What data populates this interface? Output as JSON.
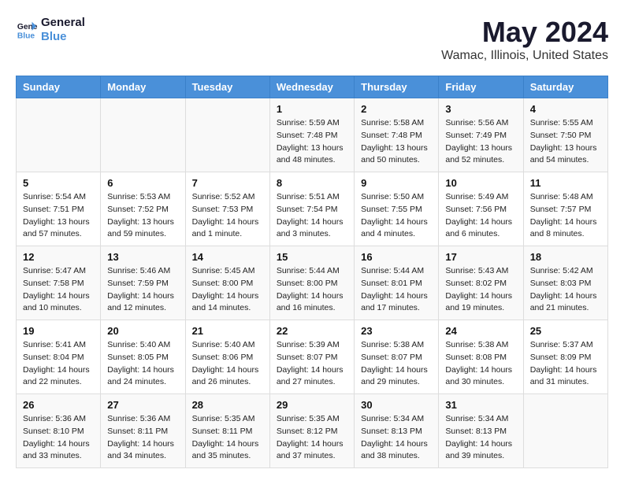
{
  "header": {
    "logo_line1": "General",
    "logo_line2": "Blue",
    "title": "May 2024",
    "subtitle": "Wamac, Illinois, United States"
  },
  "calendar": {
    "days_of_week": [
      "Sunday",
      "Monday",
      "Tuesday",
      "Wednesday",
      "Thursday",
      "Friday",
      "Saturday"
    ],
    "weeks": [
      [
        {
          "day": "",
          "sunrise": "",
          "sunset": "",
          "daylight": ""
        },
        {
          "day": "",
          "sunrise": "",
          "sunset": "",
          "daylight": ""
        },
        {
          "day": "",
          "sunrise": "",
          "sunset": "",
          "daylight": ""
        },
        {
          "day": "1",
          "sunrise": "Sunrise: 5:59 AM",
          "sunset": "Sunset: 7:48 PM",
          "daylight": "Daylight: 13 hours and 48 minutes."
        },
        {
          "day": "2",
          "sunrise": "Sunrise: 5:58 AM",
          "sunset": "Sunset: 7:48 PM",
          "daylight": "Daylight: 13 hours and 50 minutes."
        },
        {
          "day": "3",
          "sunrise": "Sunrise: 5:56 AM",
          "sunset": "Sunset: 7:49 PM",
          "daylight": "Daylight: 13 hours and 52 minutes."
        },
        {
          "day": "4",
          "sunrise": "Sunrise: 5:55 AM",
          "sunset": "Sunset: 7:50 PM",
          "daylight": "Daylight: 13 hours and 54 minutes."
        }
      ],
      [
        {
          "day": "5",
          "sunrise": "Sunrise: 5:54 AM",
          "sunset": "Sunset: 7:51 PM",
          "daylight": "Daylight: 13 hours and 57 minutes."
        },
        {
          "day": "6",
          "sunrise": "Sunrise: 5:53 AM",
          "sunset": "Sunset: 7:52 PM",
          "daylight": "Daylight: 13 hours and 59 minutes."
        },
        {
          "day": "7",
          "sunrise": "Sunrise: 5:52 AM",
          "sunset": "Sunset: 7:53 PM",
          "daylight": "Daylight: 14 hours and 1 minute."
        },
        {
          "day": "8",
          "sunrise": "Sunrise: 5:51 AM",
          "sunset": "Sunset: 7:54 PM",
          "daylight": "Daylight: 14 hours and 3 minutes."
        },
        {
          "day": "9",
          "sunrise": "Sunrise: 5:50 AM",
          "sunset": "Sunset: 7:55 PM",
          "daylight": "Daylight: 14 hours and 4 minutes."
        },
        {
          "day": "10",
          "sunrise": "Sunrise: 5:49 AM",
          "sunset": "Sunset: 7:56 PM",
          "daylight": "Daylight: 14 hours and 6 minutes."
        },
        {
          "day": "11",
          "sunrise": "Sunrise: 5:48 AM",
          "sunset": "Sunset: 7:57 PM",
          "daylight": "Daylight: 14 hours and 8 minutes."
        }
      ],
      [
        {
          "day": "12",
          "sunrise": "Sunrise: 5:47 AM",
          "sunset": "Sunset: 7:58 PM",
          "daylight": "Daylight: 14 hours and 10 minutes."
        },
        {
          "day": "13",
          "sunrise": "Sunrise: 5:46 AM",
          "sunset": "Sunset: 7:59 PM",
          "daylight": "Daylight: 14 hours and 12 minutes."
        },
        {
          "day": "14",
          "sunrise": "Sunrise: 5:45 AM",
          "sunset": "Sunset: 8:00 PM",
          "daylight": "Daylight: 14 hours and 14 minutes."
        },
        {
          "day": "15",
          "sunrise": "Sunrise: 5:44 AM",
          "sunset": "Sunset: 8:00 PM",
          "daylight": "Daylight: 14 hours and 16 minutes."
        },
        {
          "day": "16",
          "sunrise": "Sunrise: 5:44 AM",
          "sunset": "Sunset: 8:01 PM",
          "daylight": "Daylight: 14 hours and 17 minutes."
        },
        {
          "day": "17",
          "sunrise": "Sunrise: 5:43 AM",
          "sunset": "Sunset: 8:02 PM",
          "daylight": "Daylight: 14 hours and 19 minutes."
        },
        {
          "day": "18",
          "sunrise": "Sunrise: 5:42 AM",
          "sunset": "Sunset: 8:03 PM",
          "daylight": "Daylight: 14 hours and 21 minutes."
        }
      ],
      [
        {
          "day": "19",
          "sunrise": "Sunrise: 5:41 AM",
          "sunset": "Sunset: 8:04 PM",
          "daylight": "Daylight: 14 hours and 22 minutes."
        },
        {
          "day": "20",
          "sunrise": "Sunrise: 5:40 AM",
          "sunset": "Sunset: 8:05 PM",
          "daylight": "Daylight: 14 hours and 24 minutes."
        },
        {
          "day": "21",
          "sunrise": "Sunrise: 5:40 AM",
          "sunset": "Sunset: 8:06 PM",
          "daylight": "Daylight: 14 hours and 26 minutes."
        },
        {
          "day": "22",
          "sunrise": "Sunrise: 5:39 AM",
          "sunset": "Sunset: 8:07 PM",
          "daylight": "Daylight: 14 hours and 27 minutes."
        },
        {
          "day": "23",
          "sunrise": "Sunrise: 5:38 AM",
          "sunset": "Sunset: 8:07 PM",
          "daylight": "Daylight: 14 hours and 29 minutes."
        },
        {
          "day": "24",
          "sunrise": "Sunrise: 5:38 AM",
          "sunset": "Sunset: 8:08 PM",
          "daylight": "Daylight: 14 hours and 30 minutes."
        },
        {
          "day": "25",
          "sunrise": "Sunrise: 5:37 AM",
          "sunset": "Sunset: 8:09 PM",
          "daylight": "Daylight: 14 hours and 31 minutes."
        }
      ],
      [
        {
          "day": "26",
          "sunrise": "Sunrise: 5:36 AM",
          "sunset": "Sunset: 8:10 PM",
          "daylight": "Daylight: 14 hours and 33 minutes."
        },
        {
          "day": "27",
          "sunrise": "Sunrise: 5:36 AM",
          "sunset": "Sunset: 8:11 PM",
          "daylight": "Daylight: 14 hours and 34 minutes."
        },
        {
          "day": "28",
          "sunrise": "Sunrise: 5:35 AM",
          "sunset": "Sunset: 8:11 PM",
          "daylight": "Daylight: 14 hours and 35 minutes."
        },
        {
          "day": "29",
          "sunrise": "Sunrise: 5:35 AM",
          "sunset": "Sunset: 8:12 PM",
          "daylight": "Daylight: 14 hours and 37 minutes."
        },
        {
          "day": "30",
          "sunrise": "Sunrise: 5:34 AM",
          "sunset": "Sunset: 8:13 PM",
          "daylight": "Daylight: 14 hours and 38 minutes."
        },
        {
          "day": "31",
          "sunrise": "Sunrise: 5:34 AM",
          "sunset": "Sunset: 8:13 PM",
          "daylight": "Daylight: 14 hours and 39 minutes."
        },
        {
          "day": "",
          "sunrise": "",
          "sunset": "",
          "daylight": ""
        }
      ]
    ]
  }
}
